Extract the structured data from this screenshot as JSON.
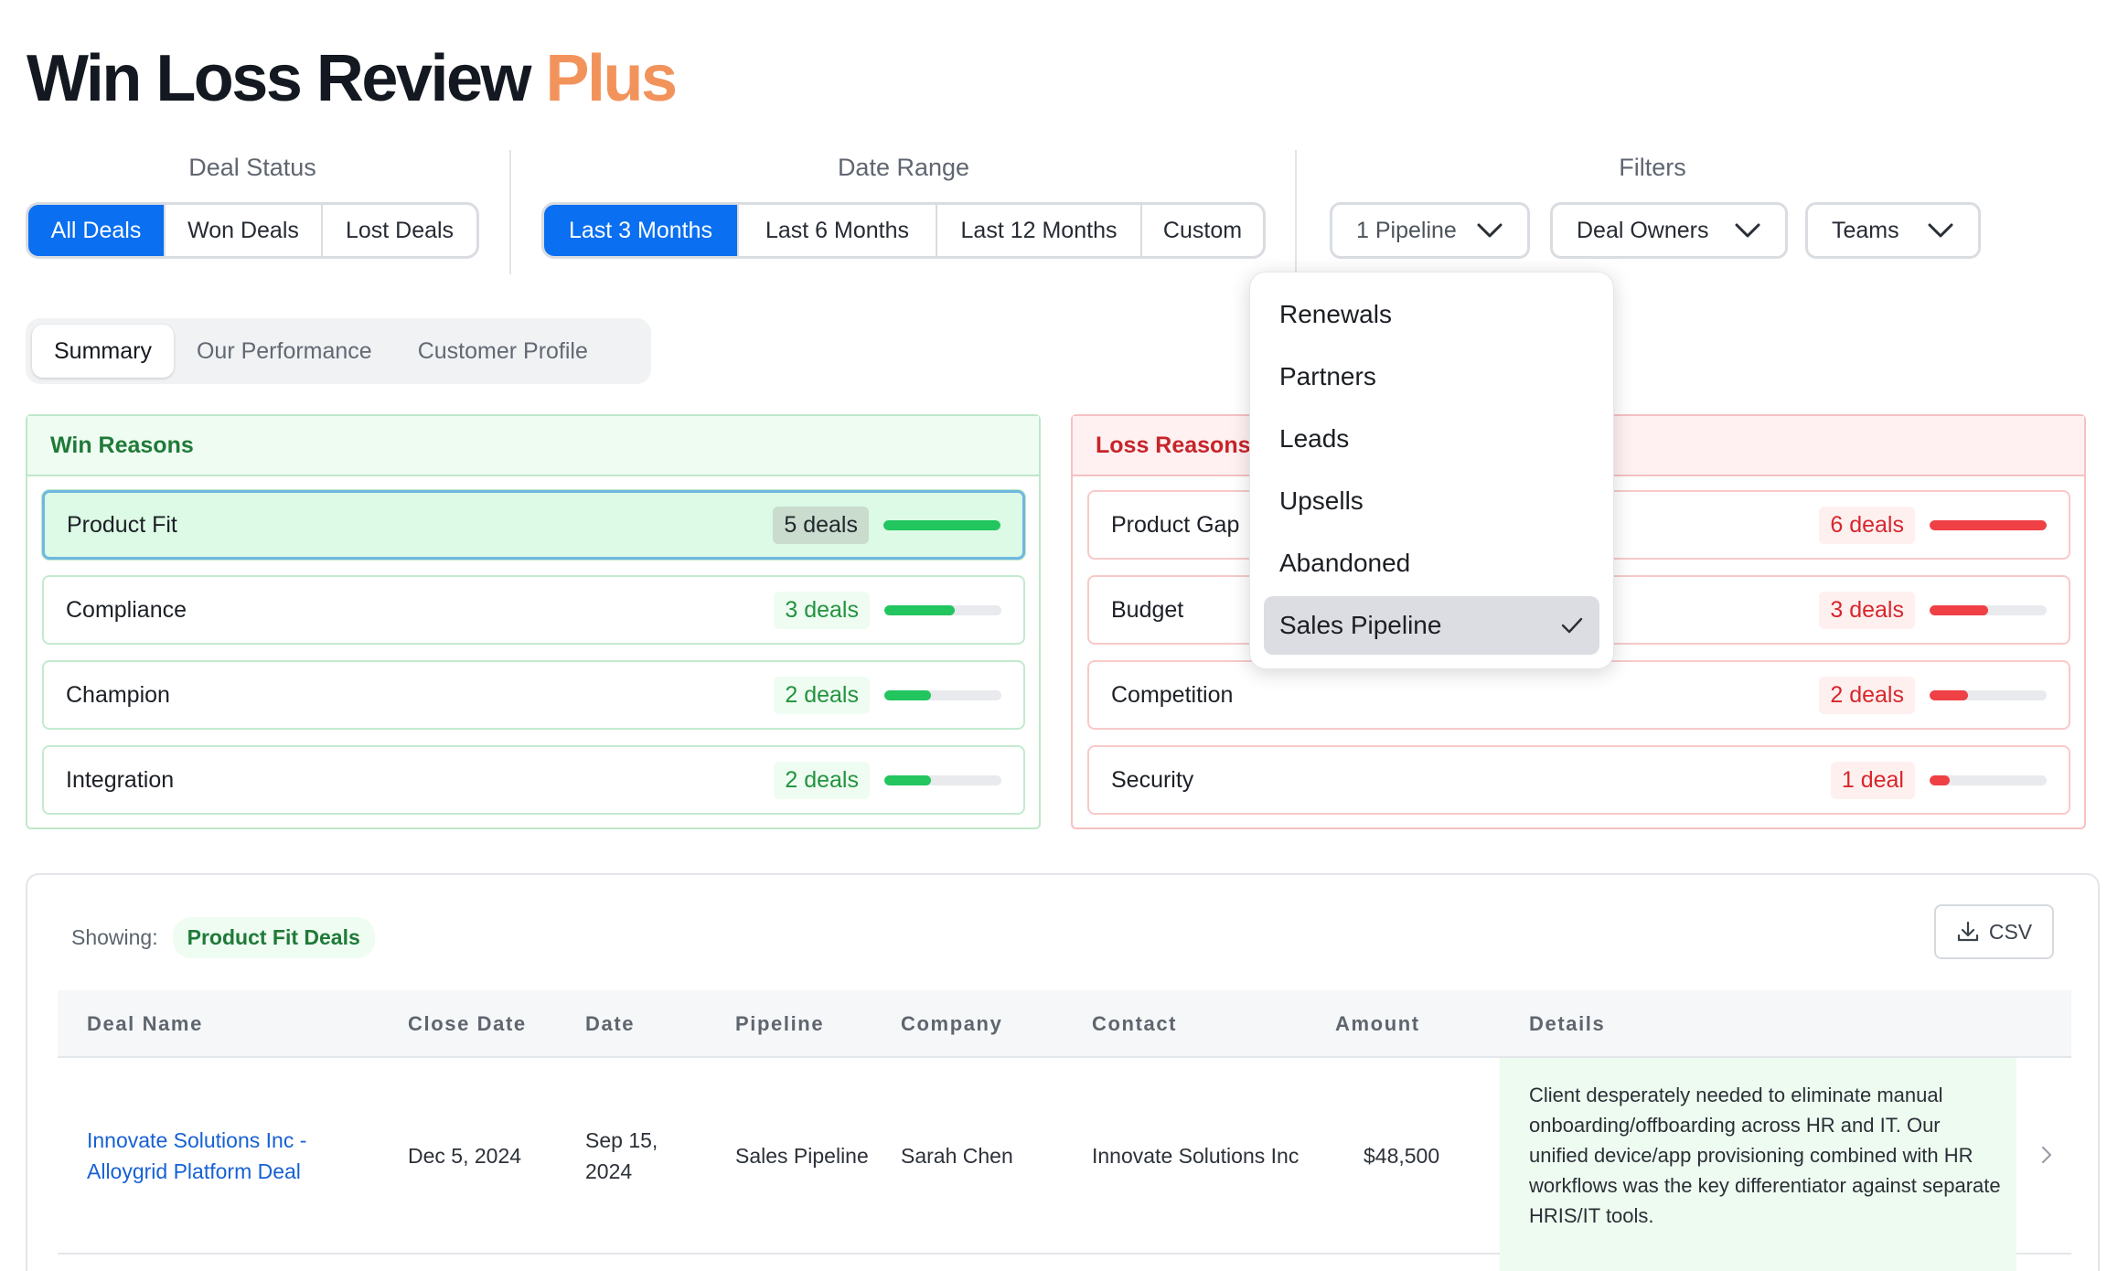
{
  "header": {
    "title_main": "Win Loss Review",
    "title_accent": "Plus"
  },
  "deal_status": {
    "label": "Deal Status",
    "options": [
      "All Deals",
      "Won Deals",
      "Lost Deals"
    ],
    "selected": "All Deals"
  },
  "date_range": {
    "label": "Date Range",
    "options": [
      "Last 3 Months",
      "Last 6 Months",
      "Last 12 Months",
      "Custom"
    ],
    "selected": "Last 3 Months"
  },
  "filters": {
    "label": "Filters",
    "pipeline": "1 Pipeline",
    "deal_owners": "Deal Owners",
    "teams": "Teams"
  },
  "pipeline_menu": {
    "items": [
      "Renewals",
      "Partners",
      "Leads",
      "Upsells",
      "Abandoned",
      "Sales Pipeline"
    ],
    "checked": "Sales Pipeline"
  },
  "tabs": {
    "items": [
      "Summary",
      "Our Performance",
      "Customer Profile"
    ],
    "active": "Summary"
  },
  "win_reasons": {
    "title": "Win Reasons",
    "items": [
      {
        "name": "Product Fit",
        "count": "5 deals",
        "fraction": 1.0
      },
      {
        "name": "Compliance",
        "count": "3 deals",
        "fraction": 0.6
      },
      {
        "name": "Champion",
        "count": "2 deals",
        "fraction": 0.4
      },
      {
        "name": "Integration",
        "count": "2 deals",
        "fraction": 0.4
      }
    ]
  },
  "loss_reasons": {
    "title": "Loss Reasons",
    "items": [
      {
        "name": "Product Gap",
        "count": "6 deals",
        "fraction": 1.0
      },
      {
        "name": "Budget",
        "count": "3 deals",
        "fraction": 0.5
      },
      {
        "name": "Competition",
        "count": "2 deals",
        "fraction": 0.33
      },
      {
        "name": "Security",
        "count": "1 deal",
        "fraction": 0.17
      }
    ]
  },
  "table": {
    "showing_label": "Showing:",
    "showing_value": "Product Fit Deals",
    "csv_label": "CSV",
    "columns": [
      "Deal Name",
      "Close Date",
      "Date",
      "Pipeline",
      "Company",
      "Contact",
      "Amount",
      "Details"
    ],
    "rows": [
      {
        "deal_name": "Innovate Solutions Inc - Alloygrid Platform Deal",
        "close_date": "Dec 5, 2024",
        "date": "Sep 15, 2024",
        "pipeline": "Sales Pipeline",
        "company": "Sarah Chen",
        "contact": "Innovate Solutions Inc",
        "amount": "$48,500",
        "details": "Client desperately needed to eliminate manual onboarding/offboarding across HR and IT. Our unified device/app provisioning combined with HR workflows was the key differentiator against separate HRIS/IT tools."
      }
    ]
  },
  "colors": {
    "accent_blue": "#0a6ff0",
    "plus_orange": "#f2935c",
    "win_green": "#22c55e",
    "loss_red": "#ef4046"
  }
}
